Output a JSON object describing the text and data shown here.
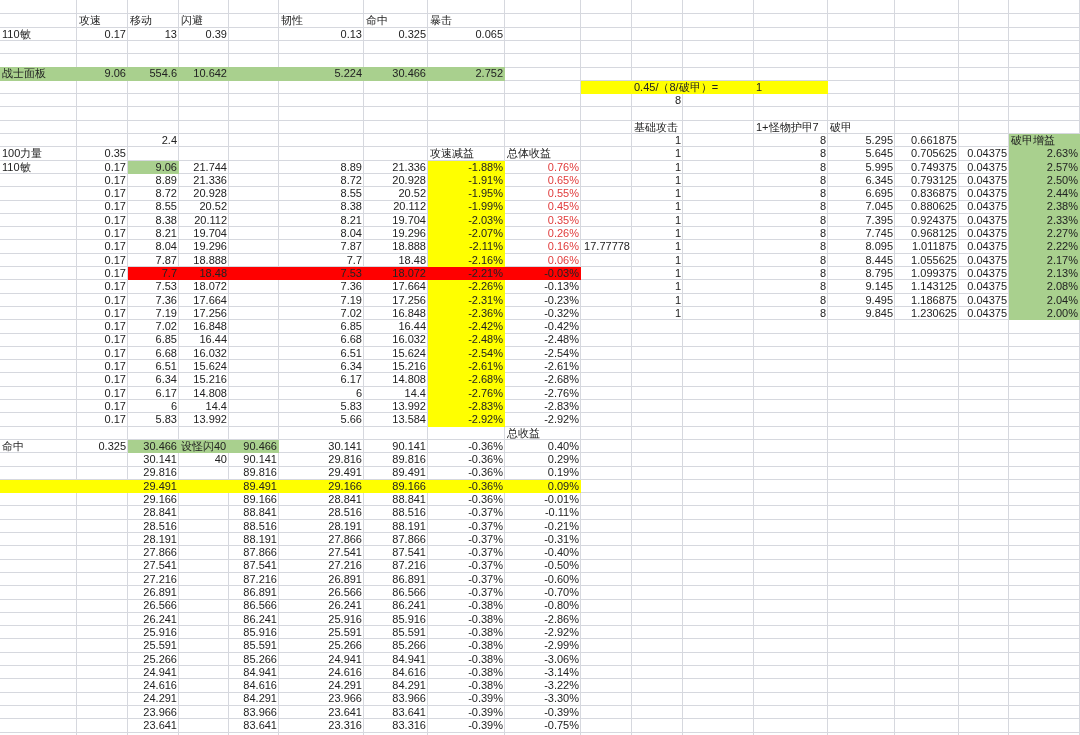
{
  "sheet": {
    "rows": [
      {},
      {
        "b": {
          "label": "攻速"
        },
        "c": {
          "label": "移动"
        },
        "d": {
          "label": "闪避"
        },
        "f": {
          "label": "韧性"
        },
        "g": {
          "label": "命中"
        },
        "h": {
          "label": "暴击"
        }
      },
      {
        "a": {
          "label": "110敏"
        },
        "b": "0.17",
        "c": "13",
        "d": "0.39",
        "f": "0.13",
        "g": "0.325",
        "h": "0.065"
      },
      {},
      {},
      {
        "a": {
          "label": "战士面板",
          "color": "#a9d08e"
        },
        "b": {
          "text": "9.06",
          "color": "#a9d08e"
        },
        "c": {
          "text": "554.6",
          "color": "#a9d08e"
        },
        "d": {
          "text": "10.642",
          "color": "#a9d08e"
        },
        "e": {
          "color": "#a9d08e"
        },
        "f": {
          "text": "5.224",
          "color": "#a9d08e"
        },
        "g": {
          "text": "30.466",
          "color": "#a9d08e"
        },
        "h": {
          "text": "2.752",
          "color": "#a9d08e"
        }
      },
      {
        "j": {
          "color": "#ffff00"
        },
        "k": {
          "label": "0.45/（8/破甲）=",
          "color": "#ffff00"
        },
        "l": {
          "color": "#ffff00"
        },
        "m": {
          "label": "1",
          "color": "#ffff00"
        }
      },
      {
        "k": "8"
      },
      {},
      {
        "k": {
          "label": "基础攻击"
        },
        "m": {
          "label": "1+怪物护甲7"
        },
        "n": {
          "label": "破甲"
        }
      },
      {
        "c": "2.4",
        "k": "1",
        "m": "8",
        "n": "5.295",
        "o": "0.661875",
        "q": {
          "label": "破甲增益",
          "color": "#a9d08e"
        }
      },
      {
        "a": {
          "label": "100力量"
        },
        "b": "0.35",
        "h": {
          "label": "攻速减益"
        },
        "i": {
          "label": "总体收益"
        },
        "k": "1",
        "m": "8",
        "n": "5.645",
        "o": "0.705625",
        "p": "0.04375",
        "q": {
          "text": "2.63%",
          "color": "#a9d08e"
        }
      },
      {
        "a": {
          "label": "110敏"
        },
        "b": "0.17",
        "c": {
          "text": "9.06",
          "color": "#a9d08e"
        },
        "d": "21.744",
        "f": "8.89",
        "g": "21.336",
        "h": {
          "text": "-1.88%",
          "color": "#ffff00"
        },
        "i": {
          "text": "0.76%",
          "emphasis": true
        },
        "k": "1",
        "m": "8",
        "n": "5.995",
        "o": "0.749375",
        "p": "0.04375",
        "q": {
          "text": "2.57%",
          "color": "#a9d08e"
        }
      },
      {
        "b": "0.17",
        "c": "8.89",
        "d": "21.336",
        "f": "8.72",
        "g": "20.928",
        "h": {
          "text": "-1.91%",
          "color": "#ffff00"
        },
        "i": {
          "text": "0.65%",
          "emphasis": true
        },
        "k": "1",
        "m": "8",
        "n": "6.345",
        "o": "0.793125",
        "p": "0.04375",
        "q": {
          "text": "2.50%",
          "color": "#a9d08e"
        }
      },
      {
        "b": "0.17",
        "c": "8.72",
        "d": "20.928",
        "f": "8.55",
        "g": "20.52",
        "h": {
          "text": "-1.95%",
          "color": "#ffff00"
        },
        "i": {
          "text": "0.55%",
          "emphasis": true
        },
        "k": "1",
        "m": "8",
        "n": "6.695",
        "o": "0.836875",
        "p": "0.04375",
        "q": {
          "text": "2.44%",
          "color": "#a9d08e"
        }
      },
      {
        "b": "0.17",
        "c": "8.55",
        "d": "20.52",
        "f": "8.38",
        "g": "20.112",
        "h": {
          "text": "-1.99%",
          "color": "#ffff00"
        },
        "i": {
          "text": "0.45%",
          "emphasis": true
        },
        "k": "1",
        "m": "8",
        "n": "7.045",
        "o": "0.880625",
        "p": "0.04375",
        "q": {
          "text": "2.38%",
          "color": "#a9d08e"
        }
      },
      {
        "b": "0.17",
        "c": "8.38",
        "d": "20.112",
        "f": "8.21",
        "g": "19.704",
        "h": {
          "text": "-2.03%",
          "color": "#ffff00"
        },
        "i": {
          "text": "0.35%",
          "emphasis": true
        },
        "k": "1",
        "m": "8",
        "n": "7.395",
        "o": "0.924375",
        "p": "0.04375",
        "q": {
          "text": "2.33%",
          "color": "#a9d08e"
        }
      },
      {
        "b": "0.17",
        "c": "8.21",
        "d": "19.704",
        "f": "8.04",
        "g": "19.296",
        "h": {
          "text": "-2.07%",
          "color": "#ffff00"
        },
        "i": {
          "text": "0.26%",
          "emphasis": true
        },
        "k": "1",
        "m": "8",
        "n": "7.745",
        "o": "0.968125",
        "p": "0.04375",
        "q": {
          "text": "2.27%",
          "color": "#a9d08e"
        }
      },
      {
        "b": "0.17",
        "c": "8.04",
        "d": "19.296",
        "f": "7.87",
        "g": "18.888",
        "h": {
          "text": "-2.11%",
          "color": "#ffff00"
        },
        "i": {
          "text": "0.16%",
          "emphasis": true
        },
        "j": "17.77778",
        "k": "1",
        "m": "8",
        "n": "8.095",
        "o": "1.011875",
        "p": "0.04375",
        "q": {
          "text": "2.22%",
          "color": "#a9d08e"
        }
      },
      {
        "b": "0.17",
        "c": "7.87",
        "d": "18.888",
        "f": "7.7",
        "g": "18.48",
        "h": {
          "text": "-2.16%",
          "color": "#ffff00"
        },
        "i": {
          "text": "0.06%",
          "emphasis": true
        },
        "k": "1",
        "m": "8",
        "n": "8.445",
        "o": "1.055625",
        "p": "0.04375",
        "q": {
          "text": "2.17%",
          "color": "#a9d08e"
        }
      },
      {
        "b": "0.17",
        "c": {
          "text": "7.7",
          "color": "#ff0000"
        },
        "d": {
          "text": "18.48",
          "color": "#ff0000"
        },
        "e": {
          "color": "#ff0000"
        },
        "f": {
          "text": "7.53",
          "color": "#ff0000"
        },
        "g": {
          "text": "18.072",
          "color": "#ff0000"
        },
        "h": {
          "text": "-2.21%",
          "color": "#ff0000"
        },
        "i": {
          "text": "-0.03%",
          "color": "#ff0000"
        },
        "k": "1",
        "m": "8",
        "n": "8.795",
        "o": "1.099375",
        "p": "0.04375",
        "q": {
          "text": "2.13%",
          "color": "#a9d08e"
        }
      },
      {
        "b": "0.17",
        "c": "7.53",
        "d": "18.072",
        "f": "7.36",
        "g": "17.664",
        "h": {
          "text": "-2.26%",
          "color": "#ffff00"
        },
        "i": "-0.13%",
        "k": "1",
        "m": "8",
        "n": "9.145",
        "o": "1.143125",
        "p": "0.04375",
        "q": {
          "text": "2.08%",
          "color": "#a9d08e"
        }
      },
      {
        "b": "0.17",
        "c": "7.36",
        "d": "17.664",
        "f": "7.19",
        "g": "17.256",
        "h": {
          "text": "-2.31%",
          "color": "#ffff00"
        },
        "i": "-0.23%",
        "k": "1",
        "m": "8",
        "n": "9.495",
        "o": "1.186875",
        "p": "0.04375",
        "q": {
          "text": "2.04%",
          "color": "#a9d08e"
        }
      },
      {
        "b": "0.17",
        "c": "7.19",
        "d": "17.256",
        "f": "7.02",
        "g": "16.848",
        "h": {
          "text": "-2.36%",
          "color": "#ffff00"
        },
        "i": "-0.32%",
        "k": "1",
        "m": "8",
        "n": "9.845",
        "o": "1.230625",
        "p": "0.04375",
        "q": {
          "text": "2.00%",
          "color": "#a9d08e"
        }
      },
      {
        "b": "0.17",
        "c": "7.02",
        "d": "16.848",
        "f": "6.85",
        "g": "16.44",
        "h": {
          "text": "-2.42%",
          "color": "#ffff00"
        },
        "i": "-0.42%"
      },
      {
        "b": "0.17",
        "c": "6.85",
        "d": "16.44",
        "f": "6.68",
        "g": "16.032",
        "h": {
          "text": "-2.48%",
          "color": "#ffff00"
        },
        "i": "-2.48%"
      },
      {
        "b": "0.17",
        "c": "6.68",
        "d": "16.032",
        "f": "6.51",
        "g": "15.624",
        "h": {
          "text": "-2.54%",
          "color": "#ffff00"
        },
        "i": "-2.54%"
      },
      {
        "b": "0.17",
        "c": "6.51",
        "d": "15.624",
        "f": "6.34",
        "g": "15.216",
        "h": {
          "text": "-2.61%",
          "color": "#ffff00"
        },
        "i": "-2.61%"
      },
      {
        "b": "0.17",
        "c": "6.34",
        "d": "15.216",
        "f": "6.17",
        "g": "14.808",
        "h": {
          "text": "-2.68%",
          "color": "#ffff00"
        },
        "i": "-2.68%"
      },
      {
        "b": "0.17",
        "c": "6.17",
        "d": "14.808",
        "f": "6",
        "g": "14.4",
        "h": {
          "text": "-2.76%",
          "color": "#ffff00"
        },
        "i": "-2.76%"
      },
      {
        "b": "0.17",
        "c": "6",
        "d": "14.4",
        "f": "5.83",
        "g": "13.992",
        "h": {
          "text": "-2.83%",
          "color": "#ffff00"
        },
        "i": "-2.83%"
      },
      {
        "b": "0.17",
        "c": "5.83",
        "d": "13.992",
        "f": "5.66",
        "g": "13.584",
        "h": {
          "text": "-2.92%",
          "color": "#ffff00"
        },
        "i": "-2.92%"
      },
      {
        "i": {
          "label": "总收益"
        }
      },
      {
        "a": {
          "label": "命中"
        },
        "b": "0.325",
        "c": {
          "text": "30.466",
          "color": "#a9d08e"
        },
        "d": {
          "label": "设怪闪40",
          "color": "#a9d08e"
        },
        "e": {
          "text": "90.466",
          "color": "#a9d08e"
        },
        "f": "30.141",
        "g": "90.141",
        "h": "-0.36%",
        "i": "0.40%"
      },
      {
        "c": "30.141",
        "d": "40",
        "e": "90.141",
        "f": "29.816",
        "g": "89.816",
        "h": "-0.36%",
        "i": "0.29%"
      },
      {
        "c": "29.816",
        "e": "89.816",
        "f": "29.491",
        "g": "89.491",
        "h": "-0.36%",
        "i": "0.19%"
      },
      {
        "a": {
          "color": "#ffff00"
        },
        "b": {
          "color": "#ffff00"
        },
        "c": {
          "text": "29.491",
          "color": "#ffff00"
        },
        "d": {
          "color": "#ffff00"
        },
        "e": {
          "text": "89.491",
          "color": "#ffff00"
        },
        "f": {
          "text": "29.166",
          "color": "#ffff00"
        },
        "g": {
          "text": "89.166",
          "color": "#ffff00"
        },
        "h": {
          "text": "-0.36%",
          "color": "#ffff00"
        },
        "i": {
          "text": "0.09%",
          "color": "#ffff00"
        }
      },
      {
        "c": "29.166",
        "e": "89.166",
        "f": "28.841",
        "g": "88.841",
        "h": "-0.36%",
        "i": "-0.01%"
      },
      {
        "c": "28.841",
        "e": "88.841",
        "f": "28.516",
        "g": "88.516",
        "h": "-0.37%",
        "i": "-0.11%"
      },
      {
        "c": "28.516",
        "e": "88.516",
        "f": "28.191",
        "g": "88.191",
        "h": "-0.37%",
        "i": "-0.21%"
      },
      {
        "c": "28.191",
        "e": "88.191",
        "f": "27.866",
        "g": "87.866",
        "h": "-0.37%",
        "i": "-0.31%"
      },
      {
        "c": "27.866",
        "e": "87.866",
        "f": "27.541",
        "g": "87.541",
        "h": "-0.37%",
        "i": "-0.40%"
      },
      {
        "c": "27.541",
        "e": "87.541",
        "f": "27.216",
        "g": "87.216",
        "h": "-0.37%",
        "i": "-0.50%"
      },
      {
        "c": "27.216",
        "e": "87.216",
        "f": "26.891",
        "g": "86.891",
        "h": "-0.37%",
        "i": "-0.60%"
      },
      {
        "c": "26.891",
        "e": "86.891",
        "f": "26.566",
        "g": "86.566",
        "h": "-0.37%",
        "i": "-0.70%"
      },
      {
        "c": "26.566",
        "e": "86.566",
        "f": "26.241",
        "g": "86.241",
        "h": "-0.38%",
        "i": "-0.80%"
      },
      {
        "c": "26.241",
        "e": "86.241",
        "f": "25.916",
        "g": "85.916",
        "h": "-0.38%",
        "i": "-2.86%"
      },
      {
        "c": "25.916",
        "e": "85.916",
        "f": "25.591",
        "g": "85.591",
        "h": "-0.38%",
        "i": "-2.92%"
      },
      {
        "c": "25.591",
        "e": "85.591",
        "f": "25.266",
        "g": "85.266",
        "h": "-0.38%",
        "i": "-2.99%"
      },
      {
        "c": "25.266",
        "e": "85.266",
        "f": "24.941",
        "g": "84.941",
        "h": "-0.38%",
        "i": "-3.06%"
      },
      {
        "c": "24.941",
        "e": "84.941",
        "f": "24.616",
        "g": "84.616",
        "h": "-0.38%",
        "i": "-3.14%"
      },
      {
        "c": "24.616",
        "e": "84.616",
        "f": "24.291",
        "g": "84.291",
        "h": "-0.38%",
        "i": "-3.22%"
      },
      {
        "c": "24.291",
        "e": "84.291",
        "f": "23.966",
        "g": "83.966",
        "h": "-0.39%",
        "i": "-3.30%"
      },
      {
        "c": "23.966",
        "e": "83.966",
        "f": "23.641",
        "g": "83.641",
        "h": "-0.39%",
        "i": "-0.39%"
      },
      {
        "c": "23.641",
        "e": "83.641",
        "f": "23.316",
        "g": "83.316",
        "h": "-0.39%",
        "i": "-0.75%"
      }
    ]
  }
}
